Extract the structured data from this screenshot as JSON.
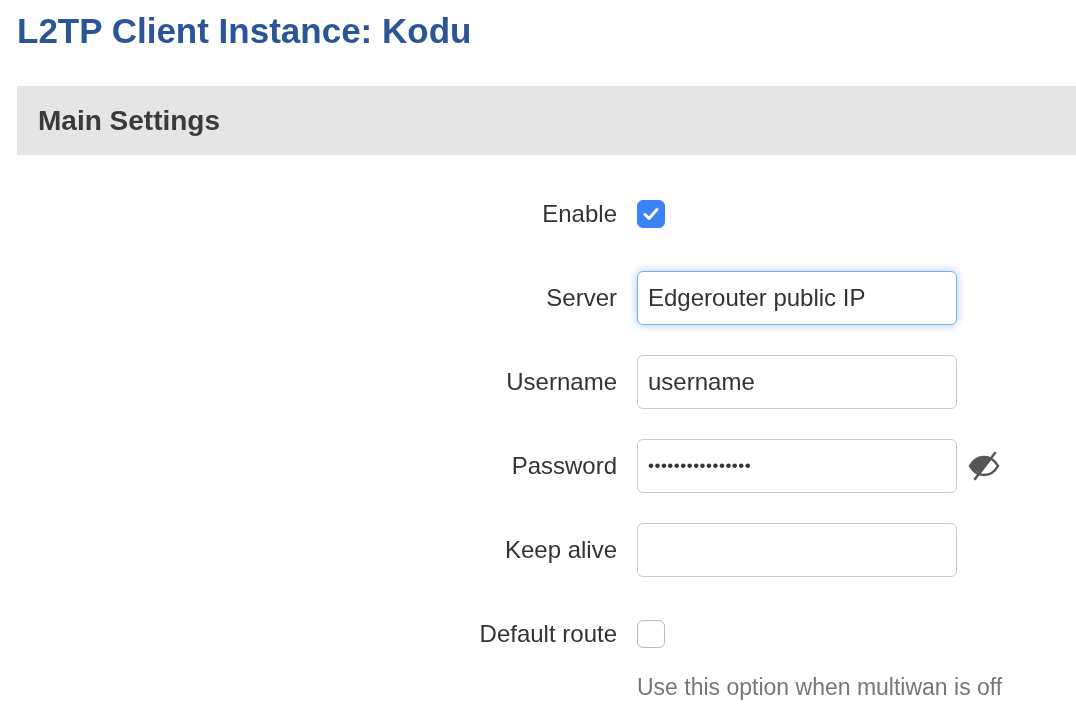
{
  "title": "L2TP Client Instance: Kodu",
  "section": {
    "title": "Main Settings"
  },
  "fields": [
    {
      "kind": "checkbox",
      "label": "Enable",
      "checked": true
    },
    {
      "kind": "text",
      "label": "Server",
      "value": "Edgerouter public IP",
      "focused": true
    },
    {
      "kind": "text",
      "label": "Username",
      "value": "username",
      "focused": false
    },
    {
      "kind": "password",
      "label": "Password",
      "value": "••••••••••••••••",
      "focused": false
    },
    {
      "kind": "text",
      "label": "Keep alive",
      "focused": false
    },
    {
      "kind": "checkbox",
      "label": "Default route",
      "checked": false,
      "hint": "Use this option when multiwan is off"
    }
  ]
}
